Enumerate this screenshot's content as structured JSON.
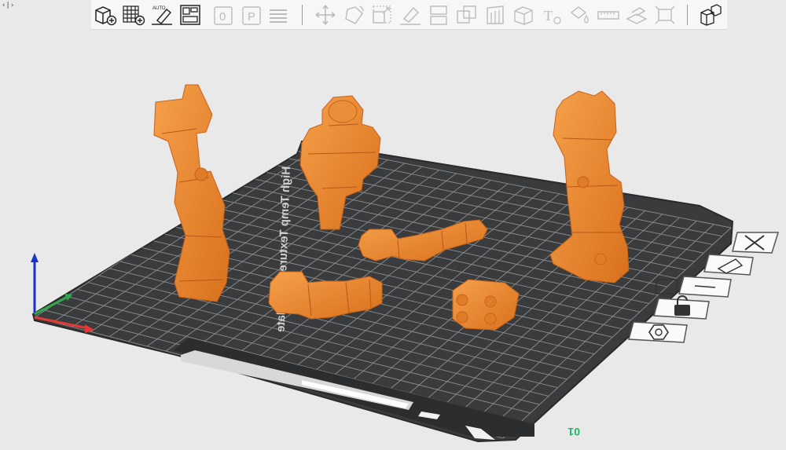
{
  "window": {
    "toggle_glyph": "‹|›"
  },
  "toolbar": {
    "items": [
      {
        "name": "add-object-button",
        "icon": "cube-plus-icon",
        "enabled": true
      },
      {
        "name": "add-plate-button",
        "icon": "grid-plus-icon",
        "enabled": true
      },
      {
        "name": "auto-orient-button",
        "icon": "auto-orient-icon",
        "label": "AUTO",
        "enabled": true
      },
      {
        "name": "arrange-button",
        "icon": "arrange-icon",
        "enabled": true
      },
      {
        "name": "plate-zero-button",
        "icon": "plate-0-icon",
        "label": "0",
        "enabled": false
      },
      {
        "name": "plate-p-button",
        "icon": "plate-p-icon",
        "label": "P",
        "enabled": false
      },
      {
        "name": "layers-button",
        "icon": "layers-icon",
        "enabled": false
      },
      {
        "name": "move-button",
        "icon": "move-icon",
        "enabled": false
      },
      {
        "name": "rotate-button",
        "icon": "rotate-icon",
        "enabled": false
      },
      {
        "name": "scale-button",
        "icon": "scale-icon",
        "enabled": false
      },
      {
        "name": "lay-on-face-button",
        "icon": "lay-on-face-icon",
        "enabled": false
      },
      {
        "name": "cut-button",
        "icon": "cut-icon",
        "enabled": false
      },
      {
        "name": "boolean-button",
        "icon": "boolean-icon",
        "enabled": false
      },
      {
        "name": "support-paint-button",
        "icon": "support-paint-icon",
        "enabled": false
      },
      {
        "name": "seam-paint-button",
        "icon": "seam-paint-icon",
        "enabled": false
      },
      {
        "name": "text-button",
        "icon": "text-icon",
        "label": "T",
        "enabled": false
      },
      {
        "name": "color-paint-button",
        "icon": "color-paint-icon",
        "enabled": false
      },
      {
        "name": "measure-button",
        "icon": "ruler-icon",
        "enabled": false
      },
      {
        "name": "assembly-button",
        "icon": "assembly-icon",
        "enabled": false
      },
      {
        "name": "fit-view-button",
        "icon": "fit-view-icon",
        "enabled": false
      },
      {
        "name": "split-objects-button",
        "icon": "split-objects-icon",
        "enabled": true
      }
    ]
  },
  "plate": {
    "printed_text": "High Temp Textured PEI Plate",
    "plate_number": "01",
    "accent_color": "#1fb866",
    "surface_color": "#3a3b3d",
    "model_color": "#f08a2c"
  },
  "plate_tools": [
    {
      "name": "delete-plate-button",
      "icon": "close-icon"
    },
    {
      "name": "auto-orient-plate-button",
      "icon": "auto-orient-icon"
    },
    {
      "name": "arrange-plate-button",
      "icon": "arrange-icon"
    },
    {
      "name": "lock-plate-button",
      "icon": "lock-icon"
    },
    {
      "name": "plate-settings-button",
      "icon": "settings-icon"
    }
  ],
  "axes": {
    "x_color": "#e53935",
    "y_color": "#2ea84a",
    "z_color": "#1a32c8"
  }
}
